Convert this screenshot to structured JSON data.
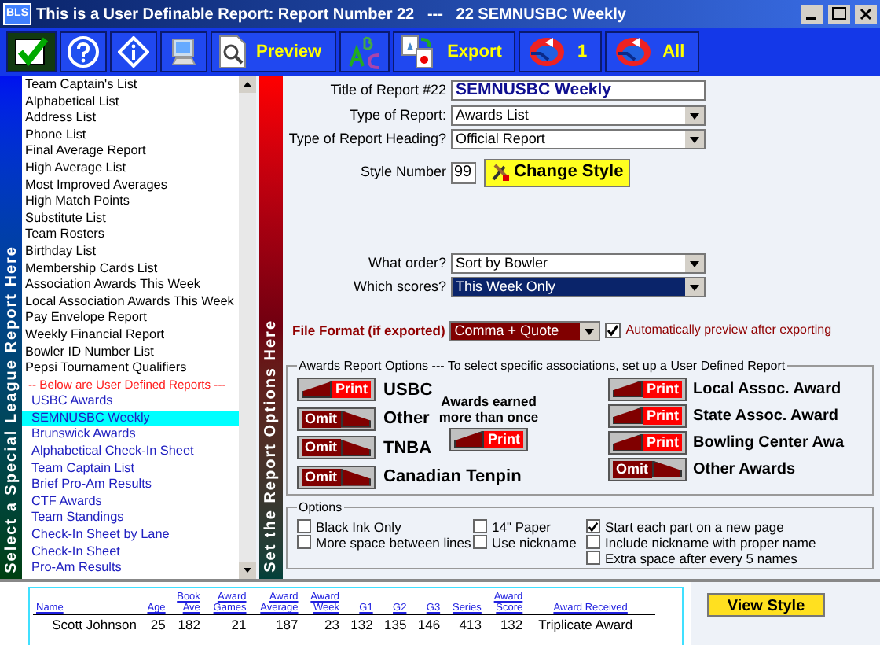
{
  "window": {
    "title": "This is a User Definable Report: Report Number 22   ---   22 SEMNUSBC Weekly",
    "app_badge": "BLS"
  },
  "toolbar": [
    {
      "kind": "check"
    },
    {
      "kind": "help"
    },
    {
      "kind": "info"
    },
    {
      "kind": "monitor"
    },
    {
      "kind": "preview",
      "label": "Preview"
    },
    {
      "kind": "spell"
    },
    {
      "kind": "export",
      "label": "Export"
    },
    {
      "kind": "refresh",
      "label": "1"
    },
    {
      "kind": "refresh",
      "label": "All"
    }
  ],
  "left_band": "Select a Special League Report Here",
  "right_band": "Set the Report Options Here",
  "reports": [
    {
      "text": "Team Captain's List",
      "kind": "standard",
      "selected": false
    },
    {
      "text": "Alphabetical List",
      "kind": "standard",
      "selected": false
    },
    {
      "text": "Address List",
      "kind": "standard",
      "selected": false
    },
    {
      "text": "Phone List",
      "kind": "standard",
      "selected": false
    },
    {
      "text": "Final Average Report",
      "kind": "standard",
      "selected": false
    },
    {
      "text": "High Average List",
      "kind": "standard",
      "selected": false
    },
    {
      "text": "Most Improved Averages",
      "kind": "standard",
      "selected": false
    },
    {
      "text": "High Match Points",
      "kind": "standard",
      "selected": false
    },
    {
      "text": "Substitute List",
      "kind": "standard",
      "selected": false
    },
    {
      "text": "Team Rosters",
      "kind": "standard",
      "selected": false
    },
    {
      "text": "Birthday List",
      "kind": "standard",
      "selected": false
    },
    {
      "text": "Membership Cards List",
      "kind": "standard",
      "selected": false
    },
    {
      "text": "Association Awards This Week",
      "kind": "standard",
      "selected": false
    },
    {
      "text": "Local Association Awards This Week",
      "kind": "standard",
      "selected": false
    },
    {
      "text": "Pay Envelope Report",
      "kind": "standard",
      "selected": false
    },
    {
      "text": "Weekly Financial Report",
      "kind": "standard",
      "selected": false
    },
    {
      "text": "Bowler ID Number List",
      "kind": "standard",
      "selected": false
    },
    {
      "text": "Pepsi Tournament Qualifiers",
      "kind": "standard",
      "selected": false
    },
    {
      "text": "-- Below are User Defined Reports ---",
      "kind": "separator",
      "selected": false
    },
    {
      "text": "USBC Awards",
      "kind": "user",
      "selected": false
    },
    {
      "text": "SEMNUSBC Weekly",
      "kind": "user",
      "selected": true
    },
    {
      "text": "Brunswick Awards",
      "kind": "user",
      "selected": false
    },
    {
      "text": "Alphabetical Check-In Sheet",
      "kind": "user",
      "selected": false
    },
    {
      "text": "Team Captain List",
      "kind": "user",
      "selected": false
    },
    {
      "text": "Brief Pro-Am Results",
      "kind": "user",
      "selected": false
    },
    {
      "text": "CTF Awards",
      "kind": "user",
      "selected": false
    },
    {
      "text": "Team Standings",
      "kind": "user",
      "selected": false
    },
    {
      "text": "Check-In Sheet by Lane",
      "kind": "user",
      "selected": false
    },
    {
      "text": "Check-In Sheet",
      "kind": "user",
      "selected": false
    },
    {
      "text": "Pro-Am Results",
      "kind": "user",
      "selected": false
    }
  ],
  "form": {
    "title_label": "Title of Report #22",
    "title_value": "SEMNUSBC Weekly",
    "type_label": "Type of Report:",
    "type_value": "Awards List",
    "heading_label": "Type of Report Heading?",
    "heading_value": "Official Report",
    "style_label": "Style Number",
    "style_value": "99",
    "change_style": "Change Style",
    "order_label": "What order?",
    "order_value": "Sort by Bowler",
    "scores_label": "Which scores?",
    "scores_value": "This Week Only",
    "format_label": "File Format (if exported)",
    "format_value": "Comma + Quote",
    "auto_preview": {
      "label": "Automatically preview after exporting",
      "checked": true
    }
  },
  "awards": {
    "title": "Awards Report Options --- To select specific associations, set up a User Defined Report",
    "left": [
      {
        "label": "USBC",
        "toggle": "Print",
        "print": true
      },
      {
        "label": "Other",
        "toggle": "Omit",
        "print": false
      },
      {
        "label": "TNBA",
        "toggle": "Omit",
        "print": false
      },
      {
        "label": "Canadian Tenpin",
        "toggle": "Omit",
        "print": false
      }
    ],
    "middle": {
      "label": "Awards earned more than once",
      "toggle": "Print",
      "print": true
    },
    "right": [
      {
        "label": "Local Assoc. Award",
        "toggle": "Print",
        "print": true
      },
      {
        "label": "State Assoc. Award",
        "toggle": "Print",
        "print": true
      },
      {
        "label": "Bowling Center Awa",
        "toggle": "Print",
        "print": true
      },
      {
        "label": "Other Awards",
        "toggle": "Omit",
        "print": false
      }
    ]
  },
  "options": {
    "title": "Options",
    "columns": [
      [
        {
          "label": "Black Ink Only",
          "checked": false
        },
        {
          "label": "More space between lines",
          "checked": false
        }
      ],
      [
        {
          "label": "14\" Paper",
          "checked": false
        },
        {
          "label": "Use nickname",
          "checked": false
        }
      ],
      [
        {
          "label": "Start each part on a new page",
          "checked": true
        },
        {
          "label": "Include nickname with proper name",
          "checked": false
        },
        {
          "label": "Extra space after every 5 names",
          "checked": false
        }
      ]
    ]
  },
  "view_style": "View Style",
  "preview_table": {
    "columns": [
      {
        "label": "Name"
      },
      {
        "label": "Age"
      },
      {
        "over": "Book",
        "label": "Ave"
      },
      {
        "over": "Award",
        "label": "Games"
      },
      {
        "over": "Award",
        "label": "Average"
      },
      {
        "over": "Award",
        "label": "Week"
      },
      {
        "label": "G1"
      },
      {
        "label": "G2"
      },
      {
        "label": "G3"
      },
      {
        "label": "Series"
      },
      {
        "over": "Award",
        "label": "Score"
      },
      {
        "label": "Award Received"
      }
    ],
    "rows": [
      [
        "Scott Johnson",
        "25",
        "182",
        "21",
        "187",
        "23",
        "132",
        "135",
        "146",
        "413",
        "132",
        "Triplicate Award"
      ]
    ]
  }
}
